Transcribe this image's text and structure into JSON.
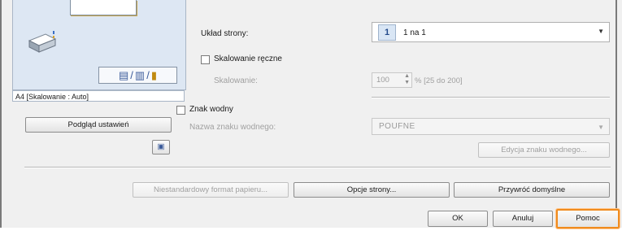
{
  "preview": {
    "caption": "A4 [Skalowanie : Auto]",
    "preview_button": "Podgląd ustawień"
  },
  "layout": {
    "label": "Układ strony:",
    "value": "1 na 1",
    "icon_number": "1"
  },
  "scaling": {
    "checkbox_label": "Skalowanie ręczne",
    "field_label": "Skalowanie:",
    "value": "100",
    "range_hint": "% [25 do 200]"
  },
  "watermark": {
    "checkbox_label": "Znak wodny",
    "name_label": "Nazwa znaku wodnego:",
    "value": "POUFNE",
    "edit_button": "Edycja znaku wodnego..."
  },
  "bottom_buttons": {
    "custom_paper": "Niestandardowy format papieru...",
    "page_options": "Opcje strony...",
    "restore_defaults": "Przywróć domyślne"
  },
  "dialog_buttons": {
    "ok": "OK",
    "cancel": "Anuluj",
    "help": "Pomoc"
  },
  "colors": {
    "highlight": "#f08b1e",
    "accent": "#244b8c"
  }
}
